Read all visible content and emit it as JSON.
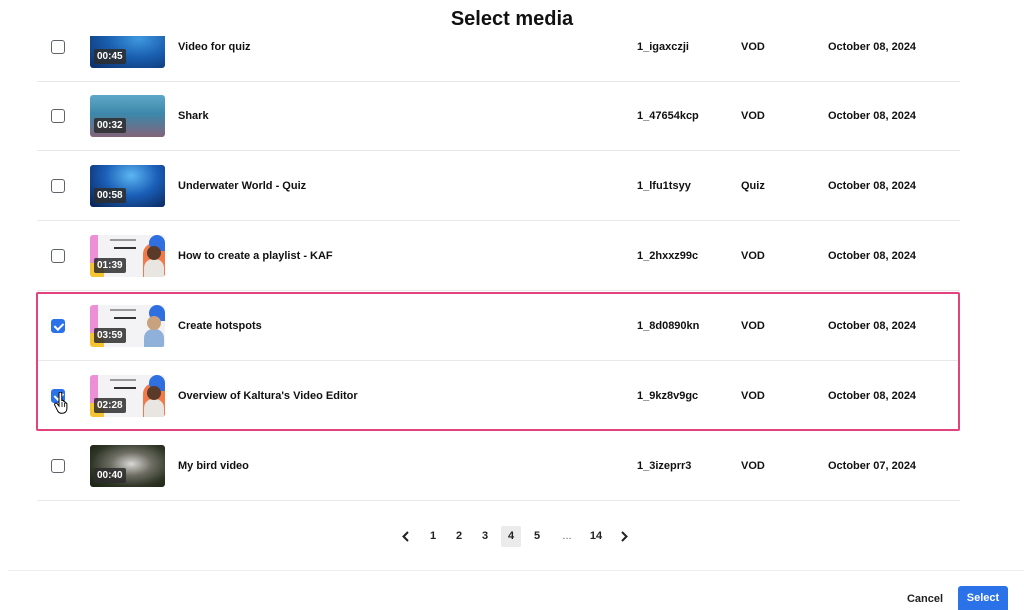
{
  "dialog": {
    "title": "Select media",
    "cancel_label": "Cancel",
    "select_label": "Select"
  },
  "media_rows": [
    {
      "name": "Video for quiz",
      "entry_id": "1_igaxczji",
      "type": "VOD",
      "date": "October 08, 2024",
      "duration": "00:45",
      "thumbnail": "ocean",
      "checked": false
    },
    {
      "name": "Shark",
      "entry_id": "1_47654kcp",
      "type": "VOD",
      "date": "October 08, 2024",
      "duration": "00:32",
      "thumbnail": "shark",
      "checked": false
    },
    {
      "name": "Underwater World - Quiz",
      "entry_id": "1_lfu1tsyy",
      "type": "Quiz",
      "date": "October 08, 2024",
      "duration": "00:58",
      "thumbnail": "deep-ocean",
      "checked": false
    },
    {
      "name": "How to create a playlist - KAF",
      "entry_id": "1_2hxxz99c",
      "type": "VOD",
      "date": "October 08, 2024",
      "duration": "01:39",
      "thumbnail": "kaltura-presenter",
      "checked": false
    },
    {
      "name": "Create hotspots",
      "entry_id": "1_8d0890kn",
      "type": "VOD",
      "date": "October 08, 2024",
      "duration": "03:59",
      "thumbnail": "kaltura-presenter",
      "checked": true
    },
    {
      "name": "Overview of Kaltura's Video Editor",
      "entry_id": "1_9kz8v9gc",
      "type": "VOD",
      "date": "October 08, 2024",
      "duration": "02:28",
      "thumbnail": "kaltura-presenter",
      "checked": true
    },
    {
      "name": "My bird video",
      "entry_id": "1_3izeprr3",
      "type": "VOD",
      "date": "October 07, 2024",
      "duration": "00:40",
      "thumbnail": "bird",
      "checked": false
    }
  ],
  "pagination": {
    "prev_icon": "chevron-left-icon",
    "next_icon": "chevron-right-icon",
    "pages": [
      "1",
      "2",
      "3",
      "4",
      "5"
    ],
    "ellipsis": "...",
    "last_page": "14",
    "current_page": "4"
  },
  "colors": {
    "accent": "#2b72e8",
    "selection_highlight": "#e2437f"
  }
}
